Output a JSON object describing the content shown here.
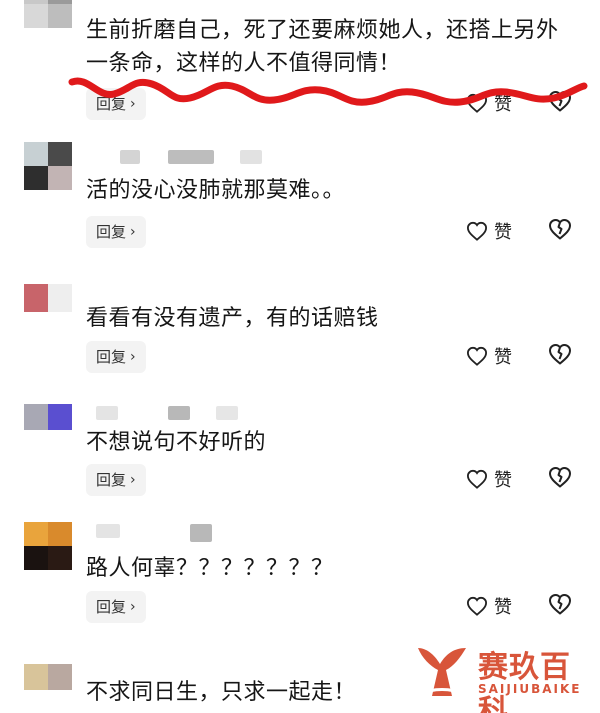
{
  "comments": [
    {
      "text_line1": "生前折磨自己，死了还要麻烦她人，还搭上另外",
      "text_line2": "一条命，这样的人不值得同情！",
      "reply_label": "回复",
      "like_label": "赞"
    },
    {
      "text": "活的没心没肺就那莫难。。",
      "reply_label": "回复",
      "like_label": "赞"
    },
    {
      "text": "看看有没有遗产，有的话赔钱",
      "reply_label": "回复",
      "like_label": "赞"
    },
    {
      "text": "不想说句不好听的",
      "reply_label": "回复",
      "like_label": "赞"
    },
    {
      "text": "路人何辜？？？？？？？",
      "reply_label": "回复",
      "like_label": "赞"
    },
    {
      "text": "不求同日生，只求一起走！"
    }
  ],
  "icons": {
    "like": "heart-outline-icon",
    "dislike": "broken-heart-icon",
    "reply": "chevron-right-icon"
  },
  "colors": {
    "annotation": "#e0191b",
    "watermark": "#d8553a"
  },
  "watermark": {
    "cn": "赛玖百科",
    "en": "SAIJIUBAIKE"
  }
}
